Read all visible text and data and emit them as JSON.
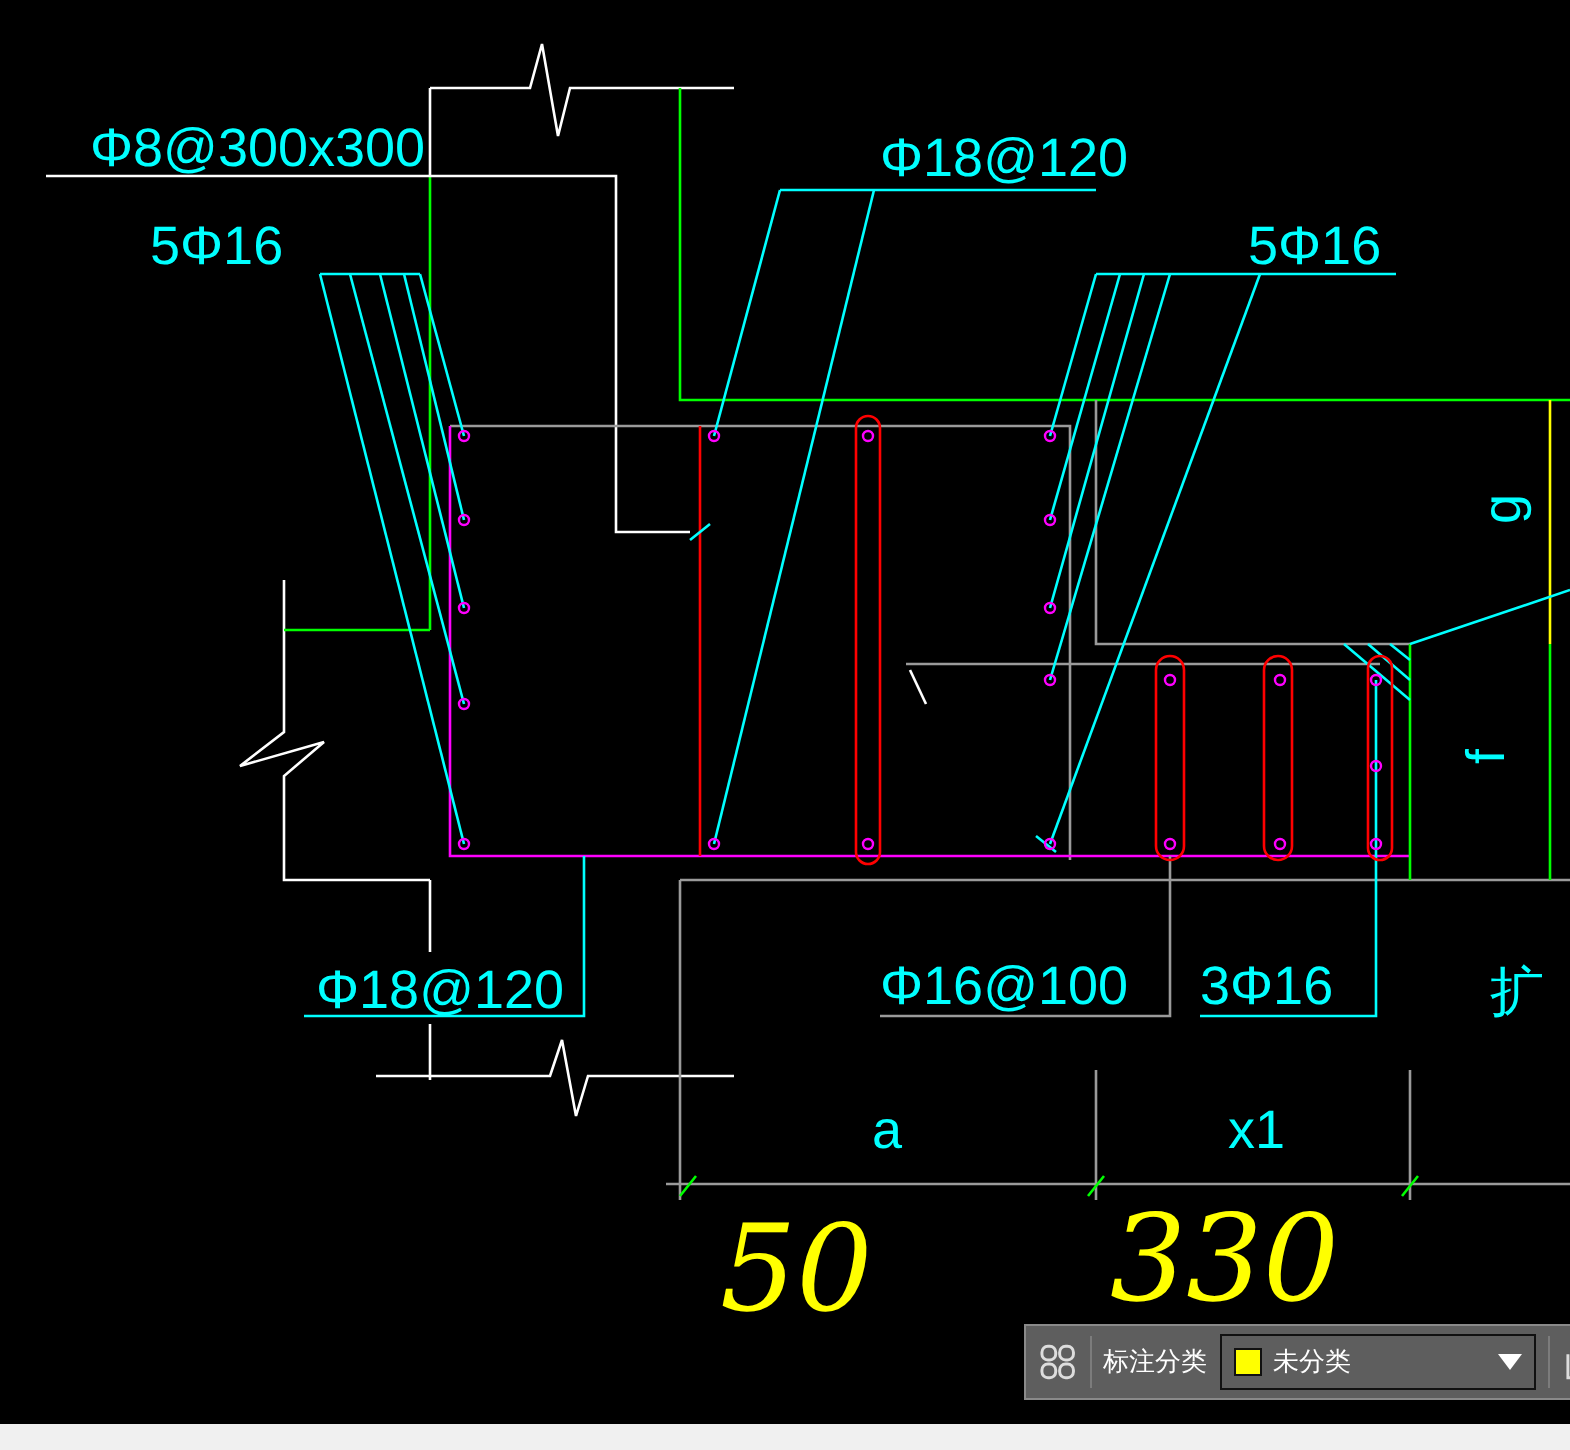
{
  "drawing": {
    "labels": [
      "Φ8@300x300",
      "Φ18@120",
      "5Φ16",
      "5Φ16",
      "Φ18@120",
      "Φ16@100",
      "3Φ16"
    ],
    "dimension_labels": [
      "g",
      "f",
      "a",
      "x1"
    ],
    "side_text": "扩",
    "handwritten_notes": [
      "50",
      "330"
    ]
  },
  "toolbar": {
    "label": "标注分类",
    "category_dropdown": {
      "value": "未分类",
      "color": "#ffff00"
    }
  }
}
